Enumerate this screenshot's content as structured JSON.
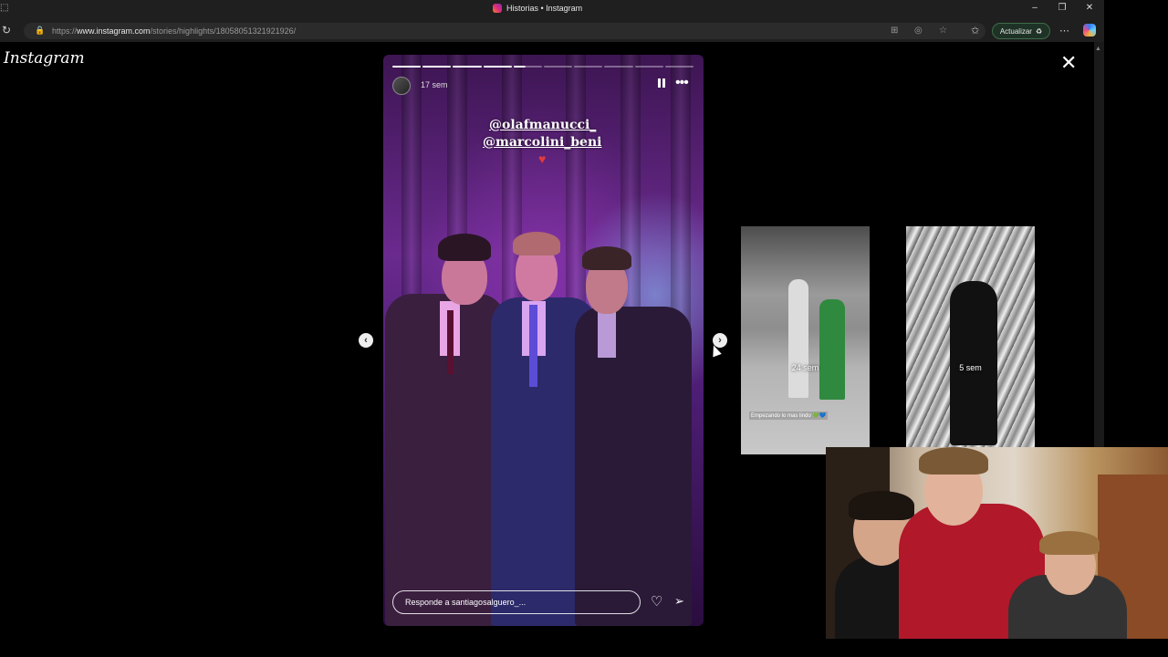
{
  "browser": {
    "tab_title": "Historias • Instagram",
    "url_prefix": "https://",
    "url_domain": "www.instagram.com",
    "url_path": "/stories/highlights/18058051321921926/",
    "update_button_label": "Actualizar",
    "icons": {
      "reload": "reload-icon",
      "lock": "lock-icon",
      "minimize": "minimize-icon",
      "restore": "restore-icon",
      "close": "close-icon"
    }
  },
  "instagram": {
    "logo": "Instagram",
    "close_label": "✕"
  },
  "story": {
    "time_ago": "17 sem",
    "mentions": [
      "@olafmanucci_",
      "@marcolini_beni"
    ],
    "progress": {
      "segments": 10,
      "completed": 4,
      "current_fraction": 0.4
    },
    "reply_placeholder": "Responde a santiagosalguero_...",
    "accent": "#6a2a8e"
  },
  "previews": [
    {
      "time_ago": "24 sem",
      "caption": "Empezando lo mas lindo 💚💙"
    },
    {
      "time_ago": "5 sem"
    }
  ]
}
